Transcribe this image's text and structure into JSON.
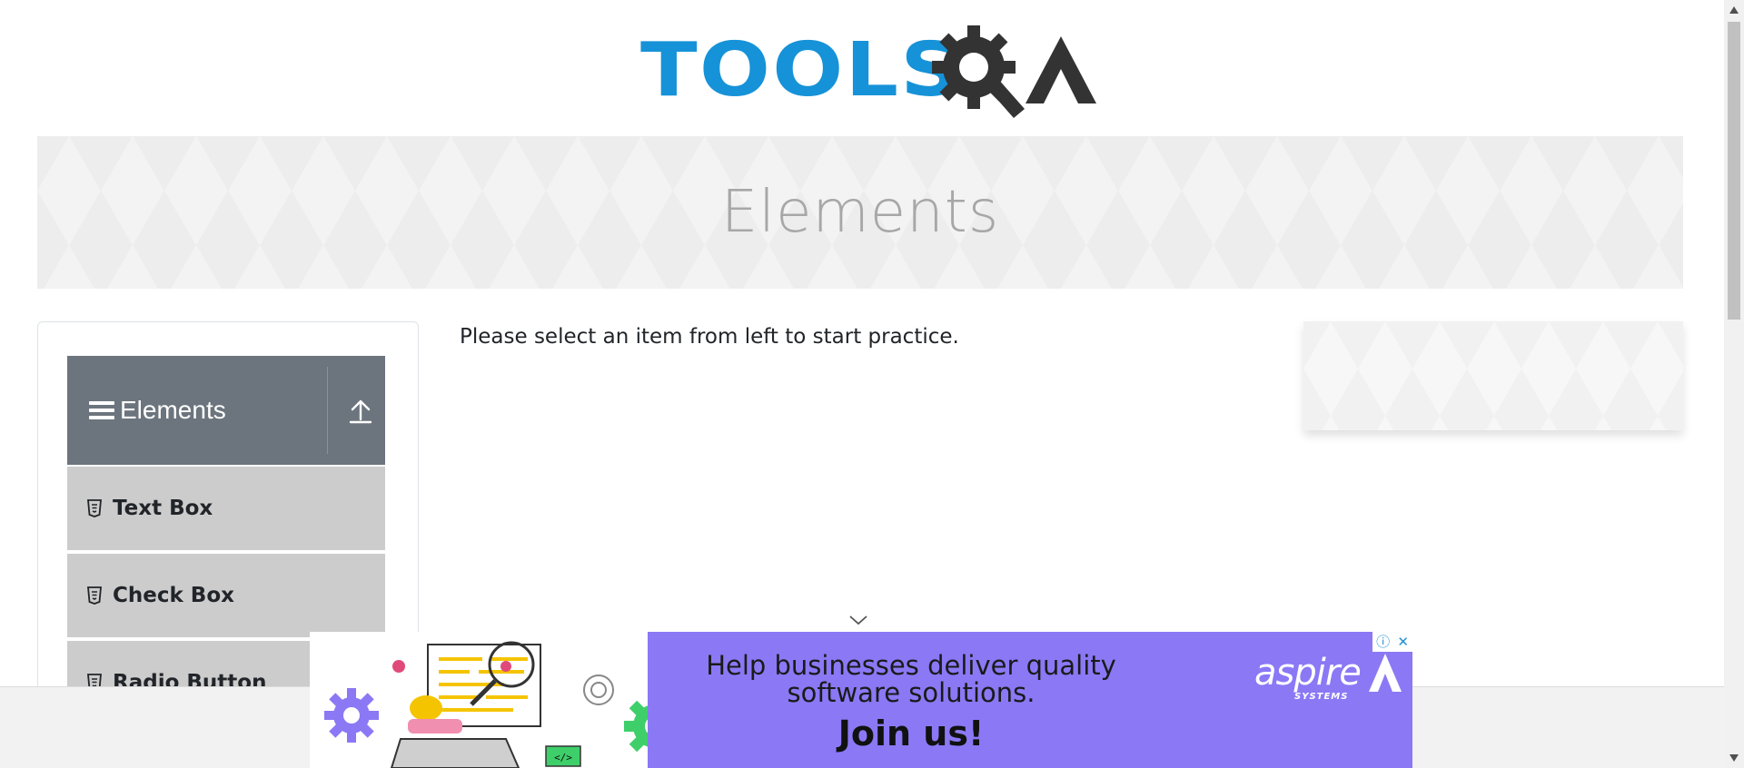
{
  "header": {
    "logo_text": "TOOLS",
    "logo_suffix": "QA"
  },
  "banner": {
    "title": "Elements"
  },
  "sidebar": {
    "group": {
      "label": "Elements",
      "icon": "menu-icon",
      "action_icon": "collapse-up-icon"
    },
    "items": [
      {
        "label": "Text Box",
        "icon": "html5-icon"
      },
      {
        "label": "Check Box",
        "icon": "html5-icon"
      },
      {
        "label": "Radio Button",
        "icon": "html5-icon"
      }
    ]
  },
  "main": {
    "message": "Please select an item from left to start practice."
  },
  "ad": {
    "headline": "Help businesses deliver quality software solutions.",
    "cta": "Join us!",
    "brand": "aspire",
    "brand_sub": "SYSTEMS",
    "controls": [
      "ⓘ",
      "✕"
    ],
    "background_color": "#8b78f5"
  },
  "colors": {
    "logo_blue": "#1692d8",
    "logo_dark": "#333333",
    "sidebar_header": "#6c757d",
    "sidebar_item": "#cccccc",
    "banner_title": "#a7a7a7"
  }
}
